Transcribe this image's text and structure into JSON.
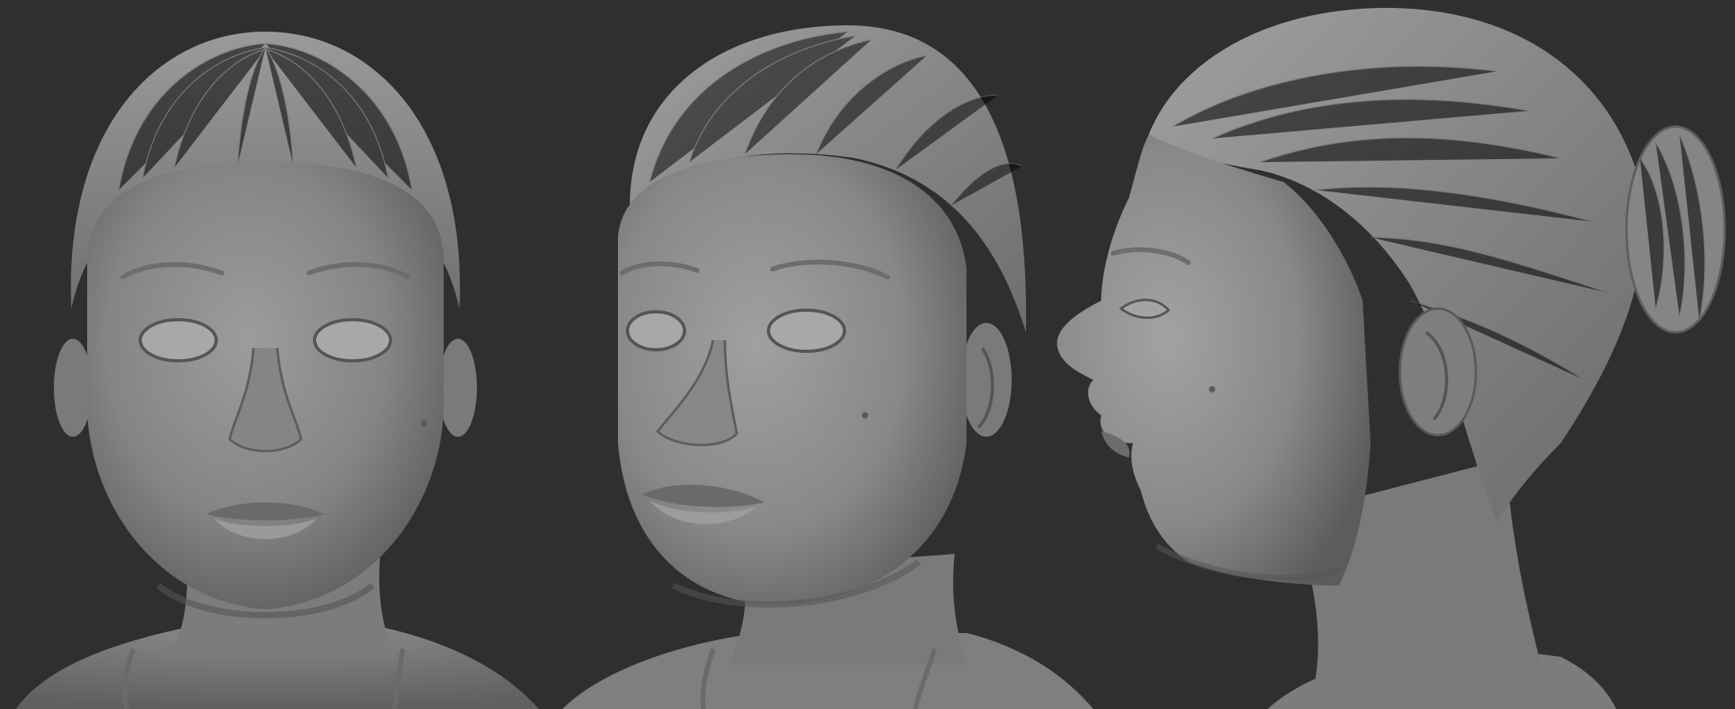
{
  "scene": {
    "background_color": "#2f2f31",
    "clay_color": "#8a8a8c",
    "clay_highlight": "#a9a9ab",
    "clay_shadow": "#4e4e50",
    "views": [
      {
        "id": "front",
        "name": "front-view"
      },
      {
        "id": "three-quarter",
        "name": "three-quarter-view"
      },
      {
        "id": "profile",
        "name": "profile-view"
      }
    ]
  }
}
